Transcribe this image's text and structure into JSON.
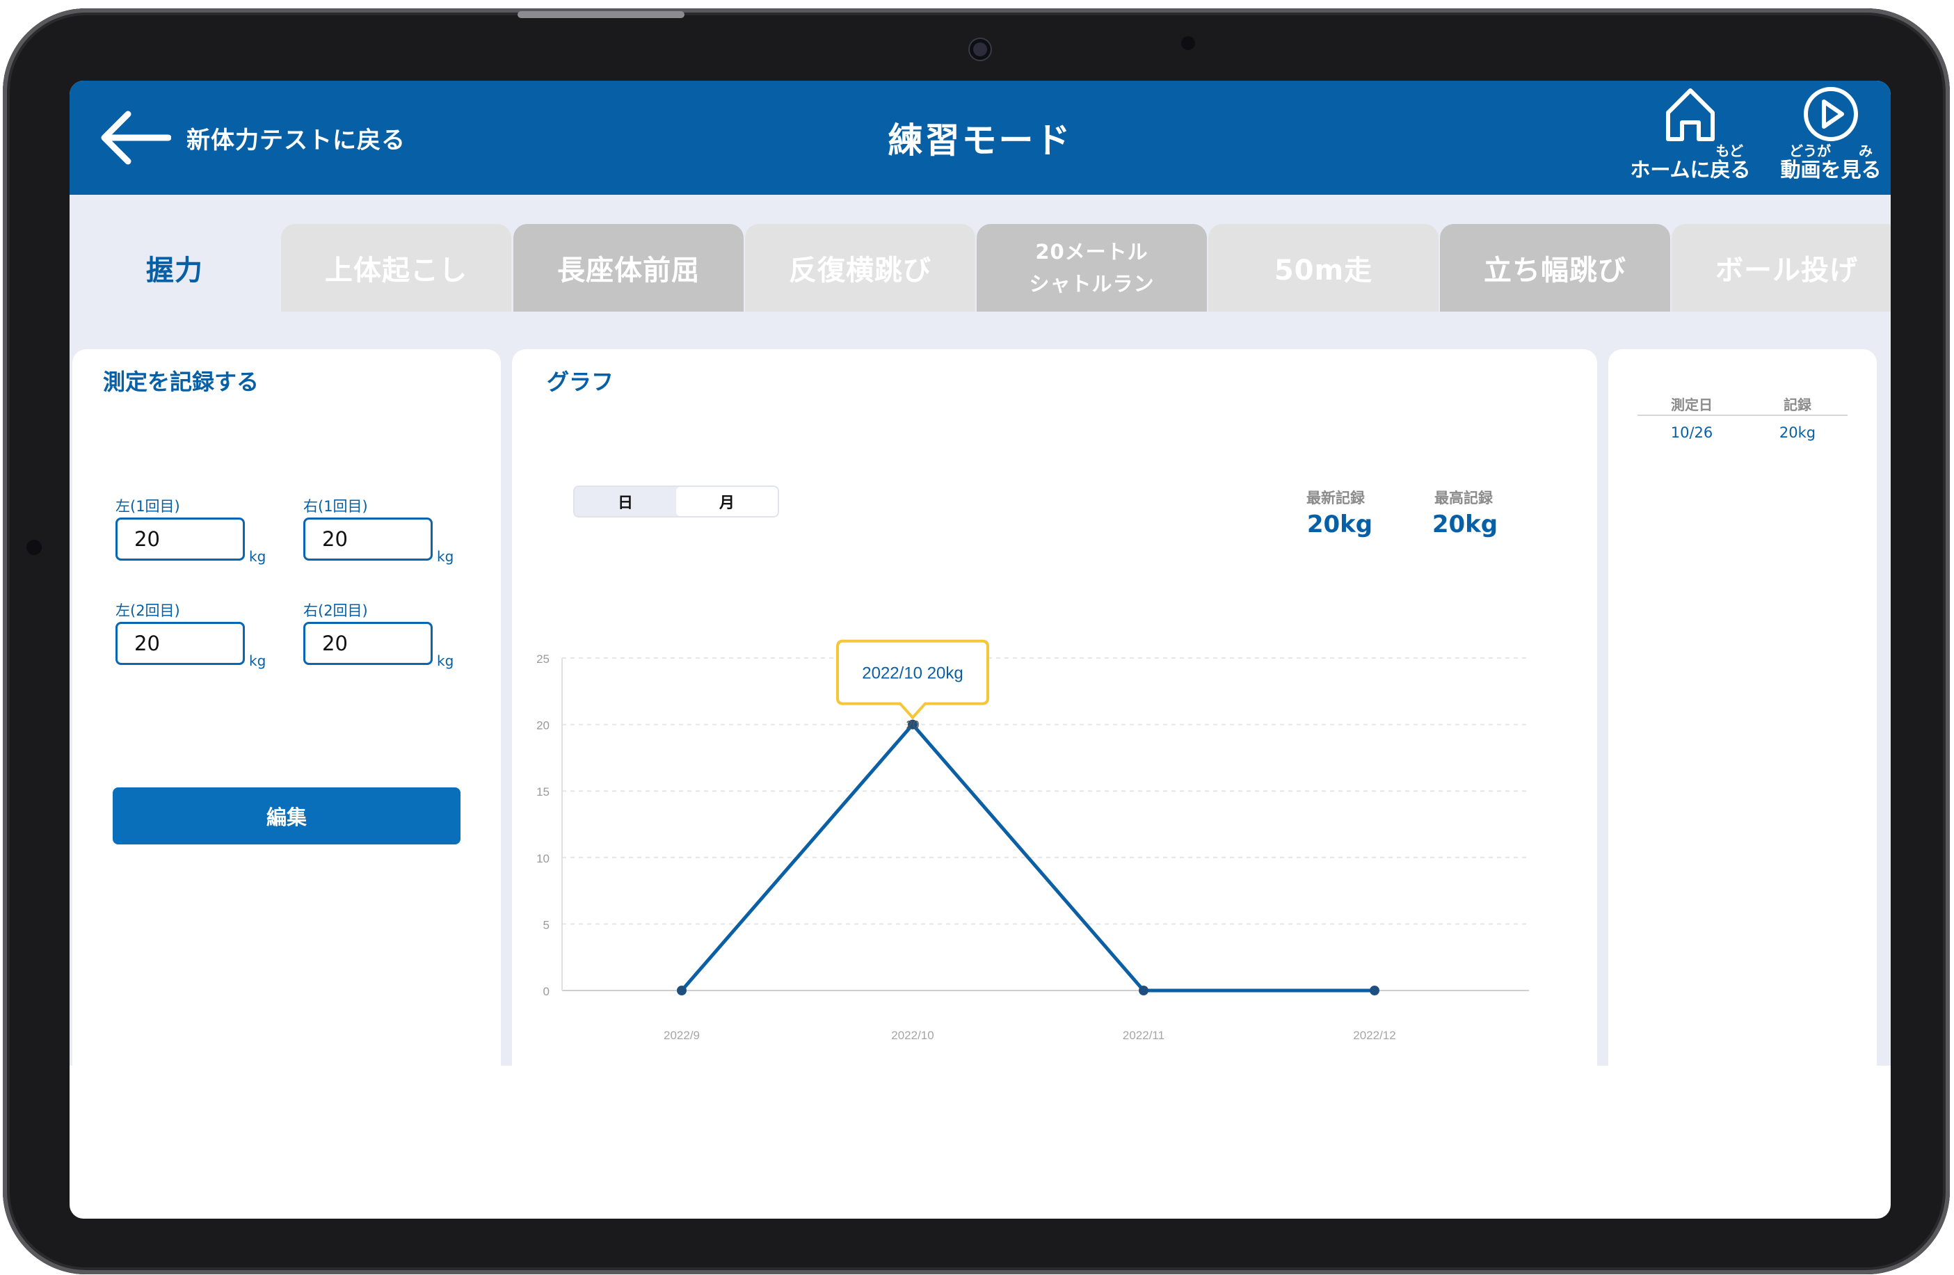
{
  "header": {
    "back_label": "新体力テストに戻る",
    "title": "練習モード",
    "home": {
      "ruby": "もど",
      "label": "ホームに戻る",
      "icon": "home-icon"
    },
    "video": {
      "ruby": "どうが　　み",
      "label": "動画を見る",
      "icon": "play-circle-icon"
    },
    "bg_color": "#0760a5"
  },
  "tabs": [
    {
      "label": "握力",
      "state": "active"
    },
    {
      "label": "上体起こし",
      "state": "light"
    },
    {
      "label": "長座体前屈",
      "state": "dark"
    },
    {
      "label": "反復横跳び",
      "state": "light"
    },
    {
      "label_line1": "20メートル",
      "label_line2": "シャトルラン",
      "state": "dark"
    },
    {
      "label": "50m走",
      "state": "light"
    },
    {
      "label": "立ち幅跳び",
      "state": "dark"
    },
    {
      "label": "ボール投げ",
      "state": "light"
    }
  ],
  "record": {
    "title": "測定を記録する",
    "fields": [
      {
        "label": "左(1回目)",
        "value": "20",
        "unit": "kg"
      },
      {
        "label": "右(1回目)",
        "value": "20",
        "unit": "kg"
      },
      {
        "label": "左(2回目)",
        "value": "20",
        "unit": "kg"
      },
      {
        "label": "右(2回目)",
        "value": "20",
        "unit": "kg"
      }
    ],
    "edit_label": "編集"
  },
  "graph": {
    "title": "グラフ",
    "toggle": {
      "day": "日",
      "month": "月",
      "selected": "day"
    },
    "latest_label": "最新記録",
    "latest_value": "20kg",
    "best_label": "最高記録",
    "best_value": "20kg",
    "tooltip": "2022/10 20kg"
  },
  "history": {
    "col_date": "測定日",
    "col_record": "記録",
    "rows": [
      {
        "date": "10/26",
        "record": "20kg"
      }
    ]
  },
  "chart_data": {
    "type": "line",
    "categories": [
      "2022/9",
      "2022/10",
      "2022/11",
      "2022/12"
    ],
    "series": [
      {
        "values": [
          0,
          20,
          0,
          0
        ]
      }
    ],
    "ylim": [
      0,
      25
    ],
    "yticks": [
      0,
      5,
      10,
      15,
      20,
      25
    ],
    "point_labels": [
      {
        "index": 1,
        "text": "20"
      }
    ],
    "grid": true,
    "color": "#0a5fa5"
  }
}
